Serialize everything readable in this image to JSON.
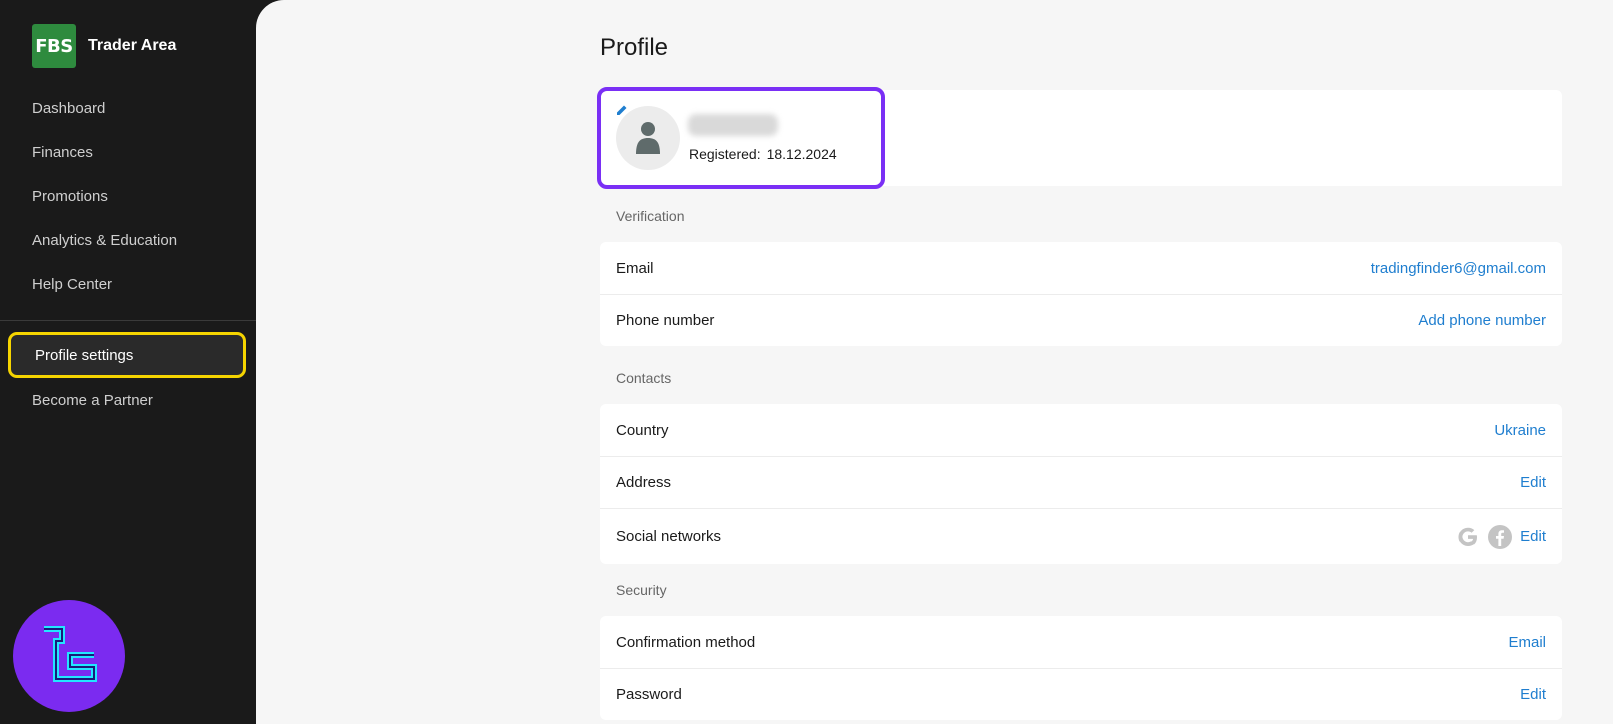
{
  "brand": {
    "logo_text": "FBS",
    "name": "Trader Area"
  },
  "nav": {
    "items": [
      {
        "label": "Dashboard"
      },
      {
        "label": "Finances"
      },
      {
        "label": "Promotions"
      },
      {
        "label": "Analytics & Education"
      },
      {
        "label": "Help Center"
      }
    ],
    "secondary": [
      {
        "label": "Profile settings",
        "active": true
      },
      {
        "label": "Become a Partner"
      }
    ]
  },
  "page": {
    "title": "Profile"
  },
  "profile": {
    "registered_label": "Registered:",
    "registered_date": "18.12.2024"
  },
  "sections": {
    "verification": {
      "label": "Verification",
      "rows": [
        {
          "label": "Email",
          "value": "tradingfinder6@gmail.com"
        },
        {
          "label": "Phone number",
          "value": "Add phone number"
        }
      ]
    },
    "contacts": {
      "label": "Contacts",
      "rows": [
        {
          "label": "Country",
          "value": "Ukraine"
        },
        {
          "label": "Address",
          "value": "Edit"
        },
        {
          "label": "Social networks",
          "value": "Edit",
          "icons": [
            "google-icon",
            "facebook-icon"
          ]
        }
      ]
    },
    "security": {
      "label": "Security",
      "rows": [
        {
          "label": "Confirmation method",
          "value": "Email"
        },
        {
          "label": "Password",
          "value": "Edit"
        }
      ]
    }
  },
  "colors": {
    "accent": "#1f7ecf",
    "brand_green": "#2e8b3e",
    "sidebar_bg": "#1a1a1a",
    "active_outline": "#f5d400",
    "profile_outline": "#7a2ff5"
  }
}
